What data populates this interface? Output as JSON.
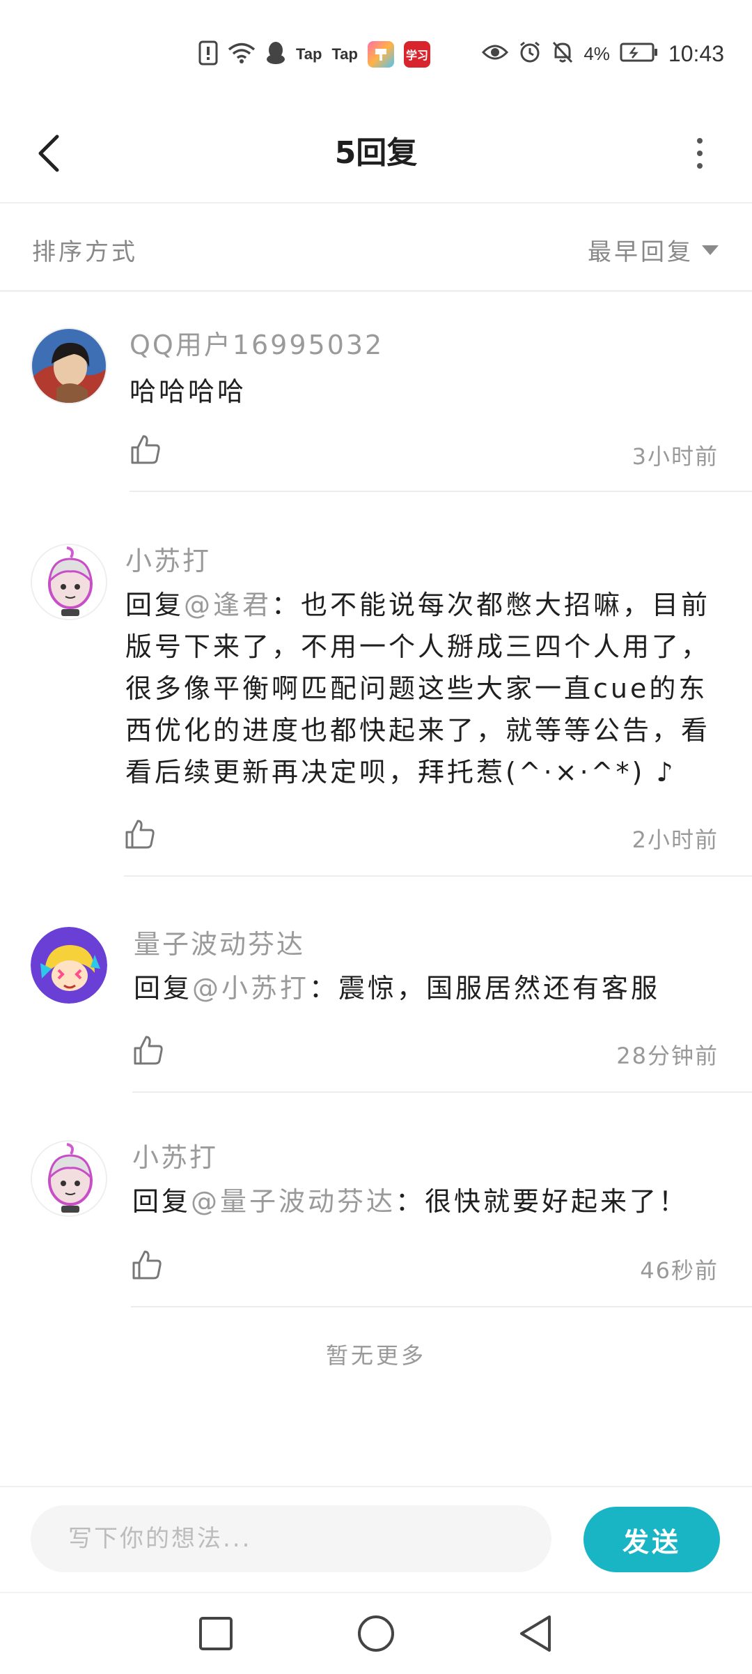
{
  "status_bar": {
    "app_label_1": "Tap",
    "app_label_2": "Tap",
    "study_app_label": "学习",
    "battery_percent": "4%",
    "time": "10:43",
    "colors": {
      "study_app": "#d8242d"
    }
  },
  "header": {
    "title": "5回复",
    "back_icon": "chevron-left-icon",
    "more_icon": "more-vertical-icon"
  },
  "sort": {
    "label": "排序方式",
    "selected": "最早回复"
  },
  "comments": [
    {
      "author": "QQ用户16995032",
      "prefix": "",
      "mention": "",
      "text": "哈哈哈哈",
      "time": "3小时前"
    },
    {
      "author": "小苏打",
      "prefix": "回复",
      "mention": "@逢君",
      "text": "：也不能说每次都憋大招嘛，目前版号下来了，不用一个人掰成三四个人用了，很多像平衡啊匹配问题这些大家一直cue的东西优化的进度也都快起来了，就等等公告，看看后续更新再决定呗，拜托惹(^·×·^*) ♪",
      "time": "2小时前"
    },
    {
      "author": "量子波动芬达",
      "prefix": "回复",
      "mention": "@小苏打",
      "text": "：震惊，国服居然还有客服",
      "time": "28分钟前"
    },
    {
      "author": "小苏打",
      "prefix": "回复",
      "mention": "@量子波动芬达",
      "text": "：很快就要好起来了！",
      "time": "46秒前"
    }
  ],
  "no_more": "暂无更多",
  "composer": {
    "placeholder": "写下你的想法...",
    "send_label": "发送",
    "send_color": "#19b5c4"
  },
  "nav": {
    "recents_icon": "square-icon",
    "home_icon": "circle-icon",
    "back_icon": "triangle-back-icon"
  }
}
